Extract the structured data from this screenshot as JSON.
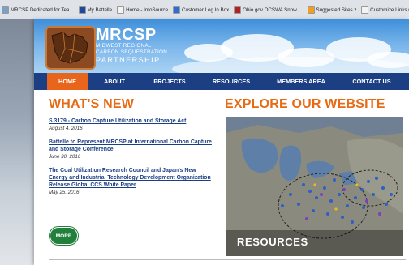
{
  "bookmarks": [
    {
      "label": "MRCSP Dedicated for Tea...",
      "icon": "page-icon",
      "color": "#7aa0c8"
    },
    {
      "label": "My Battelle",
      "icon": "battelle-icon",
      "color": "#1e4a9e"
    },
    {
      "label": "Home - InfoSource",
      "icon": "page-icon",
      "color": "#f3f3f3"
    },
    {
      "label": "Customer Log In Box",
      "icon": "box-icon",
      "color": "#2a6fd6"
    },
    {
      "label": "Ohio.gov OCSWA Snow ...",
      "icon": "ohio-icon",
      "color": "#b22222"
    },
    {
      "label": "Suggested Sites",
      "icon": "suggested-icon",
      "color": "#f0a020",
      "chevron": "▾"
    },
    {
      "label": "Customize Links Original",
      "icon": "page-icon",
      "color": "#f3f3f3"
    }
  ],
  "logo": {
    "name": "MRCSP",
    "line1": "MIDWEST REGIONAL",
    "line2": "CARBON SEQUESTRATION",
    "line3": "PARTNERSHIP"
  },
  "nav": {
    "items": [
      {
        "label": "HOME",
        "active": true
      },
      {
        "label": "ABOUT"
      },
      {
        "label": "PROJECTS"
      },
      {
        "label": "RESOURCES"
      },
      {
        "label": "MEMBERS AREA"
      },
      {
        "label": "CONTACT US"
      }
    ]
  },
  "whats_new": {
    "heading": "WHAT'S NEW",
    "items": [
      {
        "title": "S.3179 - Carbon Capture Utilization and Storage Act",
        "date": "August 4, 2016"
      },
      {
        "title": "Battelle to Represent MRCSP at International Carbon Capture and Storage Conference",
        "date": "June 30, 2016"
      },
      {
        "title": "The Coal Utilization Research Council and Japan's New Energy and Industrial Technology Development Organization Release Global CCS White Paper",
        "date": "May 25, 2016"
      }
    ],
    "more_label": "MORE"
  },
  "explore": {
    "heading": "EXPLORE OUR WEBSITE",
    "map_label": "RESOURCES"
  },
  "colors": {
    "accent_orange": "#e76a14",
    "nav_blue": "#1c3f83",
    "more_green": "#22803c"
  }
}
